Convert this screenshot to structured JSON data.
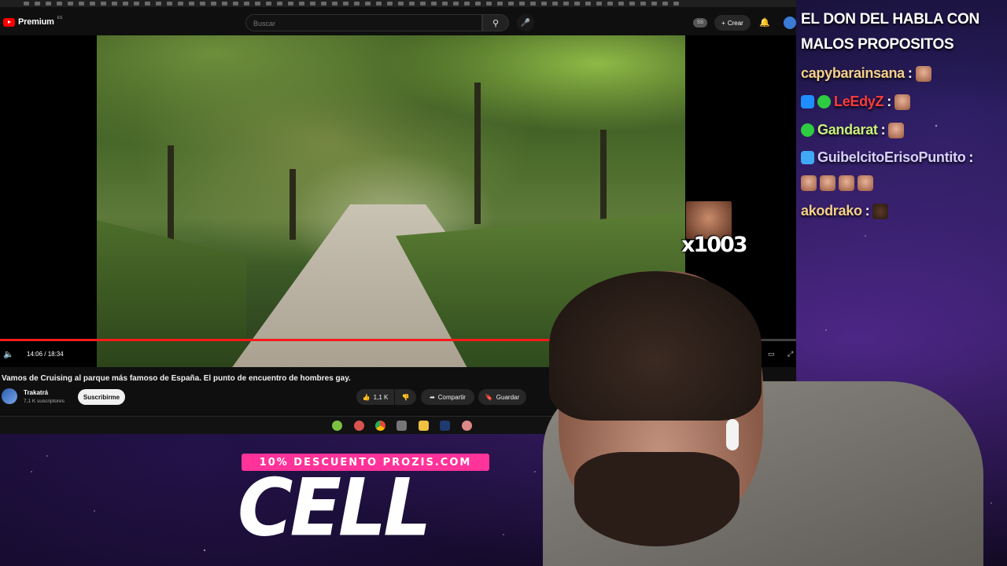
{
  "youtube": {
    "brand": "Premium",
    "region": "ES",
    "search": {
      "placeholder": "Buscar"
    },
    "ss_badge": "SS",
    "create_label": "Crear",
    "player": {
      "time": "14:06 / 18:34",
      "progress": 0.76
    },
    "video": {
      "title": "Vamos de Cruising al parque más famoso de España. El punto de encuentro de hombres gay.",
      "channel": "Trakatrá",
      "subscribers": "7,1 K suscriptores",
      "subscribe_label": "Suscribirme",
      "likes": "1,1 K",
      "share_label": "Compartir",
      "save_label": "Guardar"
    }
  },
  "overlay": {
    "emote_count": "x1003",
    "promo_code": "10% DESCUENTO PROZIS.COM",
    "promo_big": "CELL"
  },
  "chat": {
    "message_line1": "EL DON DEL HABLA CON",
    "message_line2": "MALOS PROPOSITOS",
    "users": [
      {
        "name": "capybarainsana",
        "color": "#f5d08a"
      },
      {
        "name": "LeEdyZ",
        "color": "#ff3b3b"
      },
      {
        "name": "Gandarat",
        "color": "#c8f07a"
      },
      {
        "name": "GuibelcitoErisoPuntito",
        "color": "#d8d0ff"
      },
      {
        "name": "akodrako",
        "color": "#f5d08a"
      }
    ]
  },
  "colors": {
    "yt_red": "#ff0000",
    "promo_pink": "#ff3399"
  }
}
